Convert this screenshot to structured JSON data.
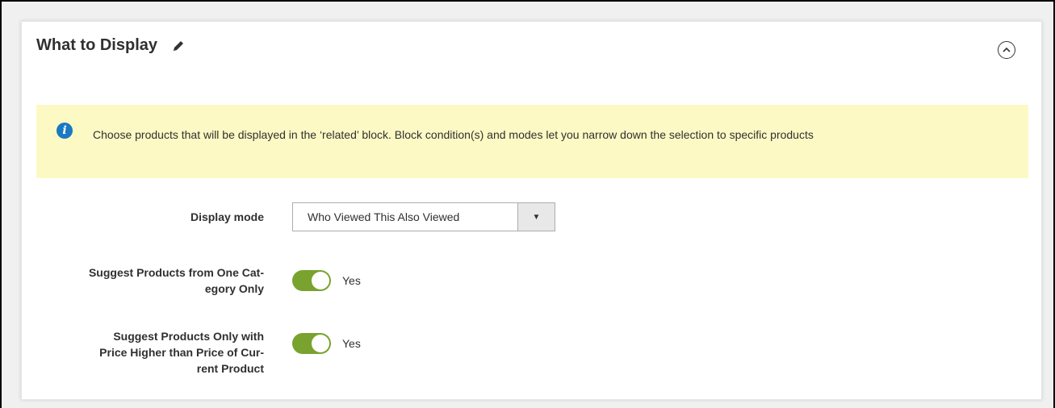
{
  "section": {
    "title": "What to Display"
  },
  "notice": {
    "text": "Choose products that will be displayed in the ‘related’ block. Block condition(s) and modes let you narrow down the selection to specific products"
  },
  "fields": {
    "display_mode": {
      "label": "Display mode",
      "value": "Who Viewed This Also Viewed"
    },
    "one_category": {
      "label": "Suggest Products from One Cat-egory Only",
      "label_line1": "Suggest Products from One Cat-",
      "label_line2": "egory Only",
      "state": "Yes",
      "enabled": true
    },
    "higher_price": {
      "label_line1": "Suggest Products Only with",
      "label_line2": "Price Higher than Price of Cur-",
      "label_line3": "rent Product",
      "state": "Yes",
      "enabled": true
    }
  },
  "colors": {
    "toggle_on": "#79a22e",
    "notice_bg": "#fdf9c4",
    "info_icon": "#1979c3"
  },
  "icons": {
    "edit": "pencil-icon",
    "collapse": "chevron-up-circle-icon",
    "info": "info-icon",
    "dropdown": "triangle-down-icon"
  }
}
